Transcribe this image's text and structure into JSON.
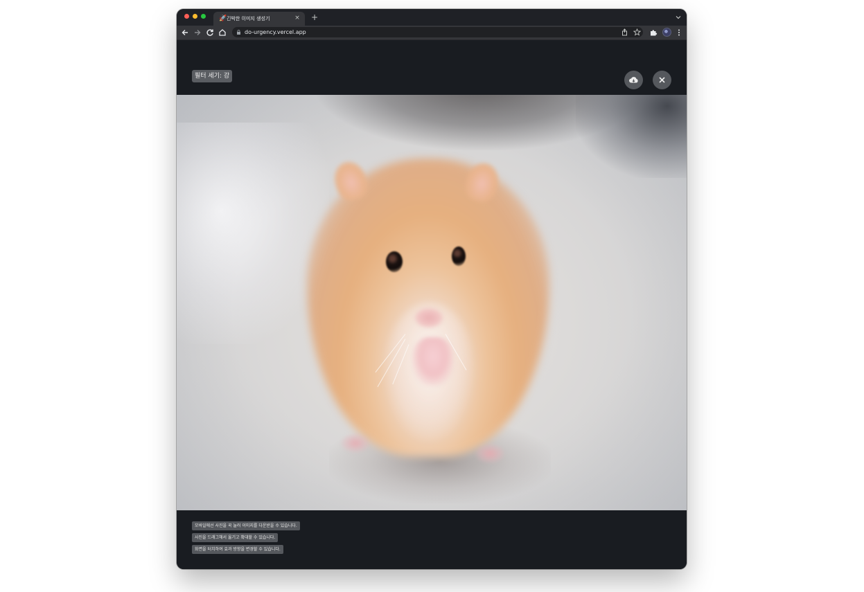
{
  "browser": {
    "tab": {
      "title": "긴박한 이미지 생성기",
      "favicon": "🚀",
      "close_glyph": "×"
    },
    "new_tab_glyph": "+",
    "address_bar": {
      "url": "do-urgency.vercel.app"
    }
  },
  "page": {
    "filter_badge": "필터 세기: 강",
    "buttons": {
      "download_icon": "cloud-download-icon",
      "close_icon": "close-icon"
    },
    "image": {
      "subject": "hamster-photo"
    },
    "hints": [
      "모바일에선 사진을 꾹 눌러 이미지를 다운받을 수 있습니다.",
      "사진을 드래그해서 옮기고 확대할 수 있습니다.",
      "화면을 터치하여 효과 방향을 변경할 수 있습니다."
    ]
  },
  "colors": {
    "page_background": "#191c21",
    "badge_background": "#5a5d62",
    "button_background": "#55585d"
  }
}
